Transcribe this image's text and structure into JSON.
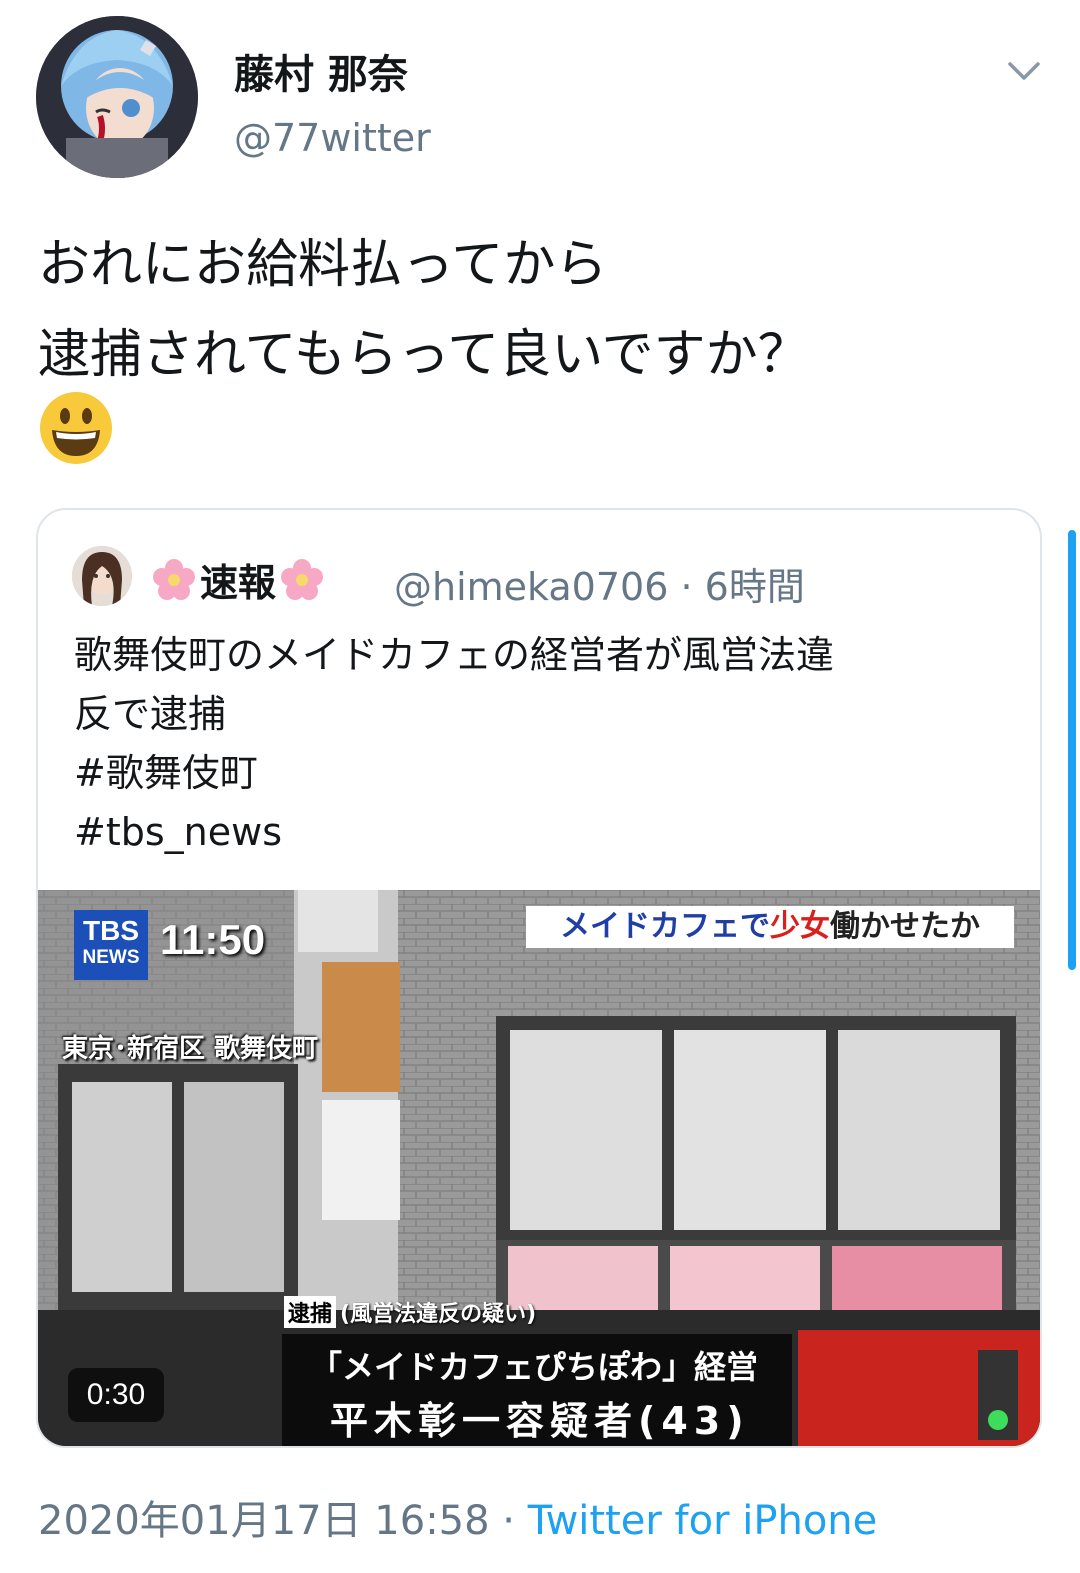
{
  "author": {
    "display_name": "藤村 那奈",
    "handle": "@77witter"
  },
  "tweet": {
    "lines": [
      "おれにお給料払ってから",
      "逮捕されてもらって良いですか？"
    ],
    "emoji": "smiley-emoji"
  },
  "quoted_tweet": {
    "name": "速報",
    "handle": "@himeka0706",
    "separator": "·",
    "time": "6時間",
    "lines": [
      "歌舞伎町のメイドカフェの経営者が風営法違",
      "反で逮捕",
      "#歌舞伎町",
      "#tbs_news"
    ],
    "video": {
      "logo_top": "TBS",
      "logo_bottom": "NEWS",
      "clock": "11:50",
      "headline_a": "メイドカフェで",
      "headline_b": "少女",
      "headline_c": "働かせたか",
      "location": "東京･新宿区 歌舞伎町",
      "caption_tag": "逮捕",
      "caption_small": "(風営法違反の疑い)",
      "caption_line1": "「メイドカフェぴちぽわ」経営",
      "caption_line2": "平木彰一容疑者(43)",
      "duration": "0:30"
    }
  },
  "footer": {
    "timestamp": "2020年01月17日 16:58",
    "separator": " · ",
    "source": "Twitter for iPhone"
  },
  "colors": {
    "accent": "#1da1f2",
    "secondary_text": "#657786",
    "border": "#dfe4e8"
  }
}
